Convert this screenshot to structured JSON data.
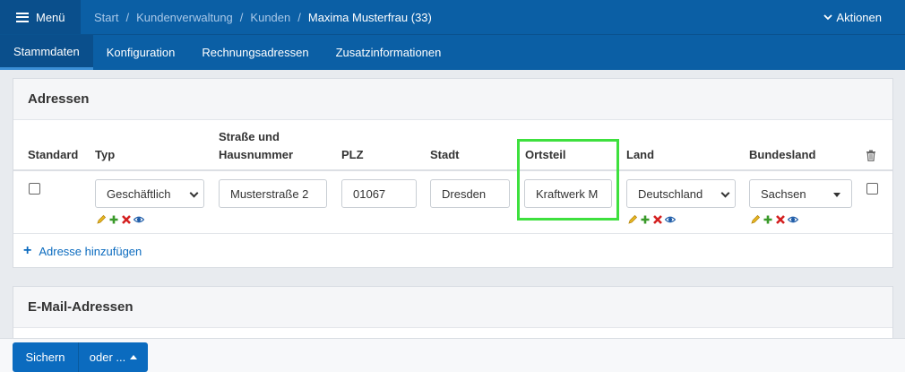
{
  "topbar": {
    "menu_label": "Menü",
    "breadcrumb": [
      "Start",
      "Kundenverwaltung",
      "Kunden"
    ],
    "separator": "/",
    "current": "Maxima Musterfrau (33)",
    "actions_label": "Aktionen"
  },
  "tabs": [
    {
      "label": "Stammdaten",
      "active": true
    },
    {
      "label": "Konfiguration"
    },
    {
      "label": "Rechnungsadressen"
    },
    {
      "label": "Zusatzinformationen"
    }
  ],
  "addresses": {
    "title": "Adressen",
    "columns": {
      "standard": "Standard",
      "typ": "Typ",
      "strasse_1": "Straße und",
      "strasse_2": "Hausnummer",
      "plz": "PLZ",
      "stadt": "Stadt",
      "ortsteil": "Ortsteil",
      "land": "Land",
      "bundesland": "Bundesland"
    },
    "row": {
      "typ": "Geschäftlich",
      "strasse": "Musterstraße 2",
      "plz": "01067",
      "stadt": "Dresden",
      "ortsteil": "Kraftwerk M",
      "land": "Deutschland",
      "bundesland": "Sachsen"
    },
    "add_label": "Adresse hinzufügen"
  },
  "email": {
    "title": "E-Mail-Adressen"
  },
  "footer": {
    "save_label": "Sichern",
    "more_label": "oder ..."
  },
  "colors": {
    "brand": "#0b5fa5",
    "highlight": "#3ee03e"
  }
}
